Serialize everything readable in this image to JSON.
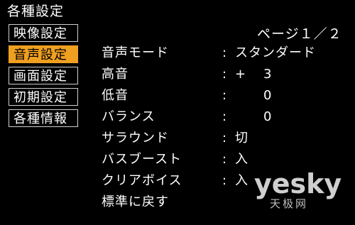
{
  "menu": {
    "title": "各種設定",
    "items": [
      {
        "label": "映像設定",
        "selected": false
      },
      {
        "label": "音声設定",
        "selected": true
      },
      {
        "label": "画面設定",
        "selected": false
      },
      {
        "label": "初期設定",
        "selected": false
      },
      {
        "label": "各種情報",
        "selected": false
      }
    ]
  },
  "page": {
    "indicator": "ページ１／２"
  },
  "settings": [
    {
      "label": "音声モード",
      "separator": ":",
      "value": "スタンダード"
    },
    {
      "label": "高音",
      "separator": ":",
      "sign": "+",
      "value": "3"
    },
    {
      "label": "低音",
      "separator": ":",
      "value": "0"
    },
    {
      "label": "バランス",
      "separator": ":",
      "value": "0"
    },
    {
      "label": "サラウンド",
      "separator": ":",
      "value": "切"
    },
    {
      "label": "バスブースト",
      "separator": ":",
      "value": "入"
    },
    {
      "label": "クリアボイス",
      "separator": ":",
      "value": "入"
    },
    {
      "label": "標準に戻す"
    }
  ],
  "watermark": {
    "brand": "yesky",
    "sub": "天极网"
  },
  "colors": {
    "background": "#000000",
    "text": "#ffffff",
    "selected_background": "#f0a020",
    "selected_text": "#000000",
    "border": "#d0d0d0"
  }
}
